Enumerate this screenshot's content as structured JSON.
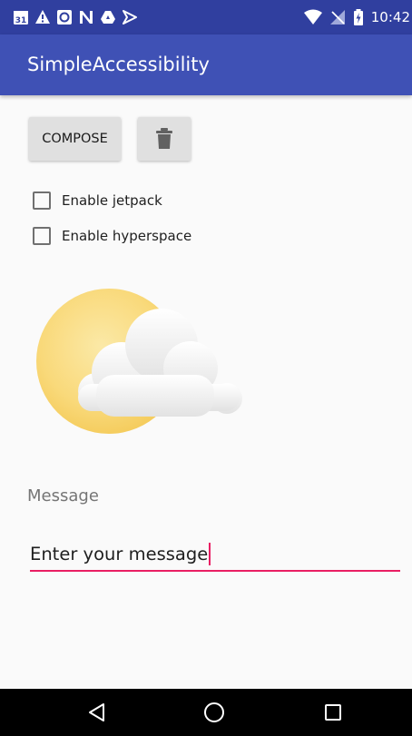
{
  "status_bar": {
    "time": "10:42",
    "left_icons": [
      "calendar-icon",
      "alert-icon",
      "app-icon",
      "n-icon",
      "drive-icon",
      "play-icon"
    ],
    "calendar_day": "31",
    "right_icons": [
      "wifi-icon",
      "no-signal-icon",
      "battery-icon"
    ]
  },
  "app_bar": {
    "title": "SimpleAccessibility",
    "color": "#3f51b5",
    "status_color": "#303f9f"
  },
  "buttons": {
    "compose_label": "COMPOSE",
    "delete_icon": "trash-icon"
  },
  "checkboxes": [
    {
      "label": "Enable jetpack",
      "checked": false
    },
    {
      "label": "Enable hyperspace",
      "checked": false
    }
  ],
  "image": {
    "icon": "partly-cloudy-icon"
  },
  "message": {
    "label": "Message",
    "value": "Enter your message",
    "accent": "#e91e63"
  },
  "nav_bar": {
    "items": [
      "back-icon",
      "home-icon",
      "recents-icon"
    ]
  }
}
